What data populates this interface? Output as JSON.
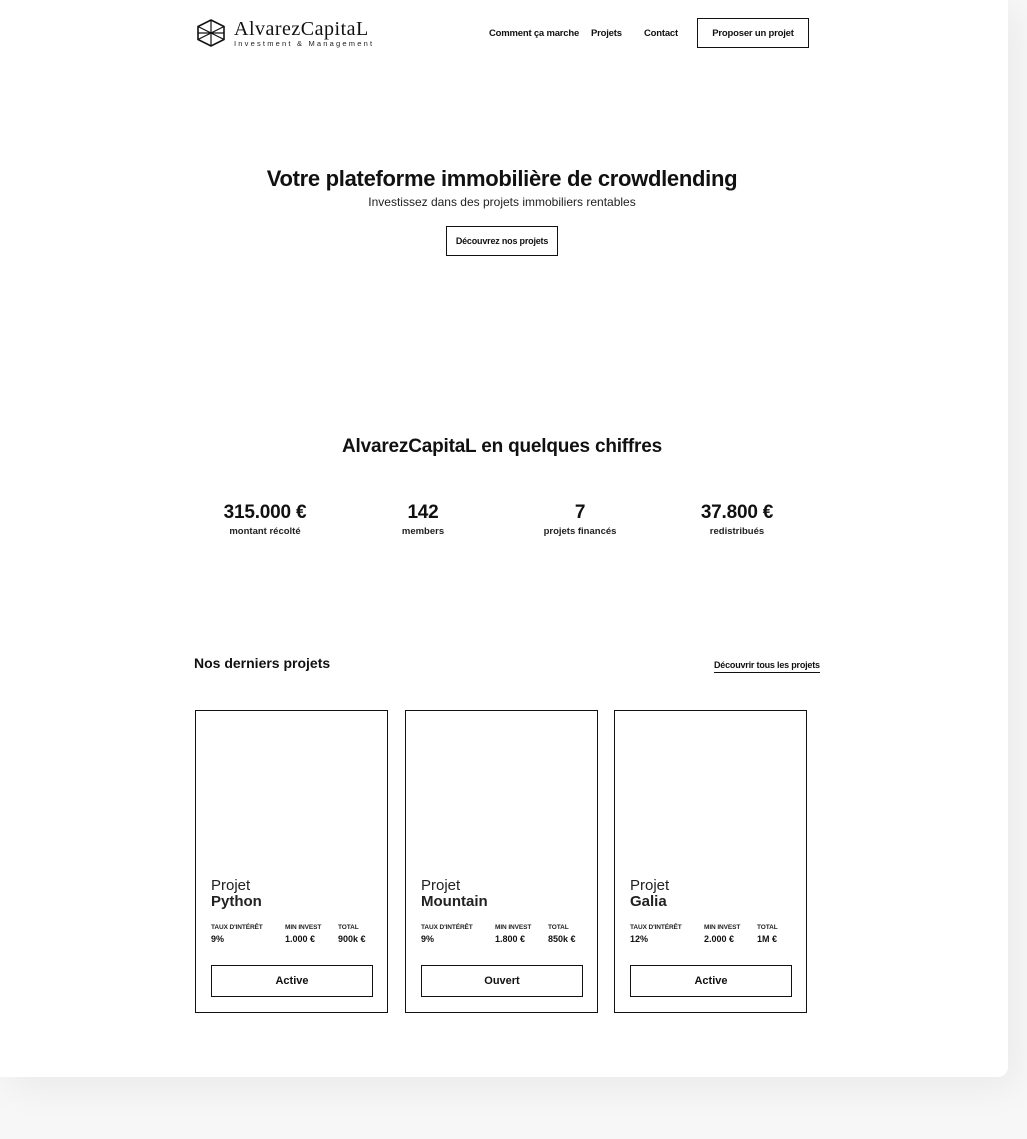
{
  "brand": {
    "name": "AlvarezCapital",
    "name_display": "AlvarezCapitaL",
    "tagline": "Investment & Management"
  },
  "nav": {
    "links": [
      "Comment ça marche",
      "Projets",
      "Contact"
    ],
    "cta": "Proposer un projet"
  },
  "hero": {
    "title": "Votre plateforme immobilière de crowdlending",
    "subtitle": "Investissez dans des projets immobiliers rentables",
    "button": "Découvrez nos projets"
  },
  "stats": {
    "title_suffix": "en quelques chiffres",
    "items": [
      {
        "value": "315.000 €",
        "label": "montant récolté"
      },
      {
        "value": "142",
        "label": "members"
      },
      {
        "value": "7",
        "label": "projets financés"
      },
      {
        "value": "37.800 €",
        "label": "redistribués"
      }
    ]
  },
  "projects": {
    "title": "Nos derniers projets",
    "link": "Découvrir tous les projets",
    "metric_labels": [
      "TAUX D'INTÉRÊT",
      "MIN INVEST",
      "TOTAL"
    ],
    "cards": [
      {
        "kicker": "Projet",
        "name": "Python",
        "rate": "9%",
        "min": "1.000 €",
        "total": "900k €",
        "status": "Active"
      },
      {
        "kicker": "Projet",
        "name": "Mountain",
        "rate": "9%",
        "min": "1.800 €",
        "total": "850k €",
        "status": "Ouvert"
      },
      {
        "kicker": "Projet",
        "name": "Galia",
        "rate": "12%",
        "min": "2.000 €",
        "total": "1M €",
        "status": "Active"
      }
    ]
  }
}
